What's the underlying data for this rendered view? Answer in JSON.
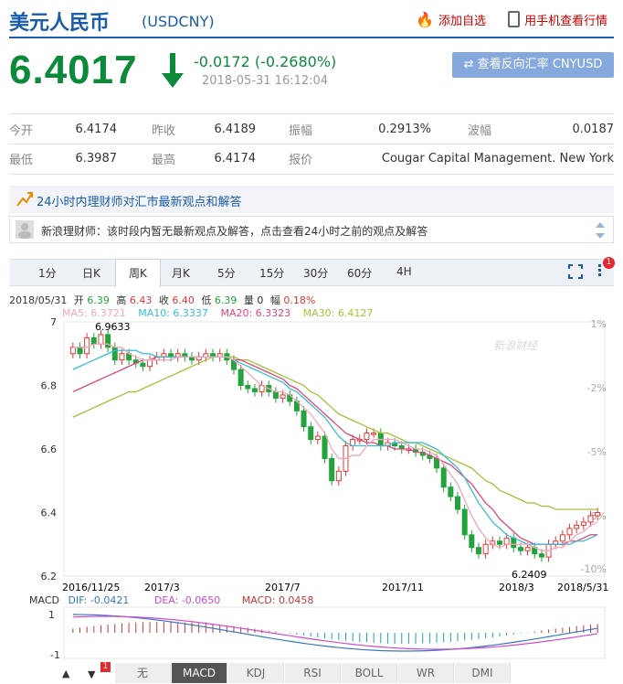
{
  "header": {
    "title": "美元人民币",
    "code": "(USDCNY)",
    "add_watch": "添加自选",
    "mobile": "用手机查看行情"
  },
  "quote": {
    "price": "6.4017",
    "change": "-0.0172 (-0.2680%)",
    "time": "2018-05-31 16:12:04",
    "reverse_btn": "⇄ 查看反向汇率 CNYUSD"
  },
  "stats": {
    "row1": [
      {
        "label": "今开",
        "value": "6.4174"
      },
      {
        "label": "昨收",
        "value": "6.4189"
      },
      {
        "label": "振幅",
        "value": "0.2913%"
      },
      {
        "label": "波幅",
        "value": "0.0187"
      }
    ],
    "row2": [
      {
        "label": "最低",
        "value": "6.3987"
      },
      {
        "label": "最高",
        "value": "6.4174"
      },
      {
        "label": "报价",
        "value": "Cougar Capital Management. New York"
      }
    ]
  },
  "news": {
    "heading": "24小时内理财师对汇市最新观点和解答",
    "line": "新浪理财师：该时段内暂无最新观点及解答，点击查看24小时之前的观点及解答"
  },
  "tabs": [
    "1分",
    "日K",
    "周K",
    "月K",
    "5分",
    "15分",
    "30分",
    "60分",
    "4H"
  ],
  "active_tab": "周K",
  "badge": "1",
  "bottom_badge": "1",
  "candle_info": {
    "date": "2018/05/31",
    "open_l": "开",
    "open": "6.39",
    "high_l": "高",
    "high": "6.43",
    "close_l": "收",
    "close": "6.40",
    "low_l": "低",
    "low": "6.39",
    "vol_l": "量",
    "vol": "0",
    "amp_l": "幅",
    "amp": "0.18%"
  },
  "ma": {
    "ma5": "MA5: 6.3721",
    "ma10": "MA10: 6.3337",
    "ma20": "MA20: 6.3323",
    "ma30": "MA30: 6.4127"
  },
  "colors": {
    "ma5": "#f3a6b9",
    "ma10": "#37bdd6",
    "ma20": "#e0457b",
    "ma30": "#a3c23a",
    "up": "#e53935",
    "down": "#22a33c"
  },
  "watermark": "新浪财经",
  "chart_data": {
    "type": "candlestick",
    "y_ticks": [
      "7",
      "6.8",
      "6.6",
      "6.4",
      "6.2"
    ],
    "y_right_ticks": [
      "1%",
      "-2%",
      "-5%",
      "-8%",
      "-10%"
    ],
    "x_ticks": [
      "2016/11/25",
      "2017/3",
      "2017/7",
      "2017/11",
      "2018/3",
      "2018/5/31"
    ],
    "ylim": [
      6.2,
      7.0
    ],
    "max_label": "6.9633",
    "min_label": "6.2409",
    "closes": [
      6.92,
      6.9,
      6.95,
      6.93,
      6.96,
      6.92,
      6.88,
      6.9,
      6.88,
      6.87,
      6.86,
      6.88,
      6.89,
      6.9,
      6.89,
      6.9,
      6.89,
      6.88,
      6.89,
      6.9,
      6.89,
      6.9,
      6.88,
      6.85,
      6.8,
      6.79,
      6.78,
      6.8,
      6.78,
      6.76,
      6.77,
      6.75,
      6.72,
      6.67,
      6.63,
      6.64,
      6.57,
      6.5,
      6.53,
      6.61,
      6.63,
      6.63,
      6.65,
      6.65,
      6.61,
      6.62,
      6.61,
      6.6,
      6.6,
      6.59,
      6.58,
      6.57,
      6.54,
      6.48,
      6.45,
      6.41,
      6.33,
      6.29,
      6.27,
      6.3,
      6.31,
      6.3,
      6.32,
      6.29,
      6.28,
      6.29,
      6.27,
      6.26,
      6.3,
      6.31,
      6.33,
      6.35,
      6.36,
      6.37,
      6.39,
      6.4
    ],
    "ma5_series": [
      6.92,
      6.92,
      6.92,
      6.93,
      6.93,
      6.93,
      6.92,
      6.92,
      6.9,
      6.89,
      6.88,
      6.88,
      6.88,
      6.88,
      6.88,
      6.89,
      6.89,
      6.89,
      6.89,
      6.89,
      6.89,
      6.89,
      6.89,
      6.88,
      6.86,
      6.84,
      6.82,
      6.8,
      6.79,
      6.78,
      6.78,
      6.77,
      6.75,
      6.73,
      6.71,
      6.68,
      6.65,
      6.6,
      6.57,
      6.57,
      6.58,
      6.58,
      6.61,
      6.63,
      6.63,
      6.63,
      6.63,
      6.62,
      6.61,
      6.6,
      6.6,
      6.59,
      6.58,
      6.55,
      6.52,
      6.49,
      6.44,
      6.39,
      6.35,
      6.32,
      6.3,
      6.29,
      6.3,
      6.3,
      6.3,
      6.3,
      6.29,
      6.28,
      6.28,
      6.29,
      6.29,
      6.31,
      6.33,
      6.34,
      6.36,
      6.37
    ],
    "ma10_series": [
      6.85,
      6.86,
      6.87,
      6.88,
      6.89,
      6.9,
      6.91,
      6.91,
      6.91,
      6.91,
      6.9,
      6.9,
      6.89,
      6.89,
      6.89,
      6.89,
      6.89,
      6.89,
      6.89,
      6.89,
      6.89,
      6.89,
      6.89,
      6.88,
      6.87,
      6.86,
      6.85,
      6.84,
      6.83,
      6.82,
      6.81,
      6.79,
      6.78,
      6.76,
      6.74,
      6.72,
      6.7,
      6.67,
      6.64,
      6.62,
      6.61,
      6.61,
      6.61,
      6.61,
      6.61,
      6.61,
      6.62,
      6.62,
      6.62,
      6.62,
      6.62,
      6.61,
      6.6,
      6.58,
      6.56,
      6.54,
      6.51,
      6.47,
      6.43,
      6.4,
      6.37,
      6.35,
      6.33,
      6.32,
      6.31,
      6.3,
      6.3,
      6.3,
      6.3,
      6.3,
      6.3,
      6.3,
      6.31,
      6.31,
      6.32,
      6.33
    ],
    "ma20_series": [
      6.78,
      6.79,
      6.8,
      6.81,
      6.82,
      6.83,
      6.84,
      6.85,
      6.86,
      6.87,
      6.88,
      6.88,
      6.89,
      6.89,
      6.89,
      6.89,
      6.89,
      6.89,
      6.89,
      6.89,
      6.89,
      6.89,
      6.89,
      6.88,
      6.88,
      6.87,
      6.86,
      6.85,
      6.84,
      6.83,
      6.82,
      6.8,
      6.79,
      6.77,
      6.75,
      6.73,
      6.71,
      6.69,
      6.67,
      6.65,
      6.64,
      6.63,
      6.62,
      6.62,
      6.61,
      6.61,
      6.6,
      6.6,
      6.6,
      6.59,
      6.59,
      6.58,
      6.57,
      6.56,
      6.55,
      6.53,
      6.51,
      6.49,
      6.46,
      6.43,
      6.41,
      6.38,
      6.36,
      6.34,
      6.32,
      6.31,
      6.3,
      6.3,
      6.3,
      6.3,
      6.3,
      6.31,
      6.31,
      6.32,
      6.33,
      6.33
    ],
    "ma30_series": [
      6.7,
      6.71,
      6.72,
      6.73,
      6.74,
      6.75,
      6.76,
      6.77,
      6.78,
      6.78,
      6.79,
      6.8,
      6.81,
      6.82,
      6.83,
      6.84,
      6.85,
      6.86,
      6.87,
      6.88,
      6.89,
      6.89,
      6.89,
      6.89,
      6.88,
      6.88,
      6.87,
      6.86,
      6.85,
      6.84,
      6.83,
      6.82,
      6.81,
      6.8,
      6.78,
      6.77,
      6.75,
      6.73,
      6.71,
      6.7,
      6.69,
      6.68,
      6.67,
      6.66,
      6.65,
      6.65,
      6.64,
      6.63,
      6.62,
      6.62,
      6.61,
      6.6,
      6.59,
      6.58,
      6.57,
      6.56,
      6.55,
      6.54,
      6.52,
      6.5,
      6.49,
      6.47,
      6.46,
      6.45,
      6.44,
      6.43,
      6.43,
      6.42,
      6.42,
      6.41,
      6.41,
      6.41,
      6.41,
      6.41,
      6.41,
      6.41
    ]
  },
  "macd": {
    "label": "MACD",
    "dif": "DIF: -0.0421",
    "dea": "DEA: -0.0650",
    "macd": "MACD: 0.0458",
    "y_ticks": [
      "1",
      "-1"
    ]
  },
  "bottom_tabs": [
    "无",
    "MACD",
    "KDJ",
    "RSI",
    "BOLL",
    "WR",
    "DMI"
  ],
  "bottom_active": "MACD",
  "arrows": {
    "up": "▲",
    "down": "▼"
  }
}
